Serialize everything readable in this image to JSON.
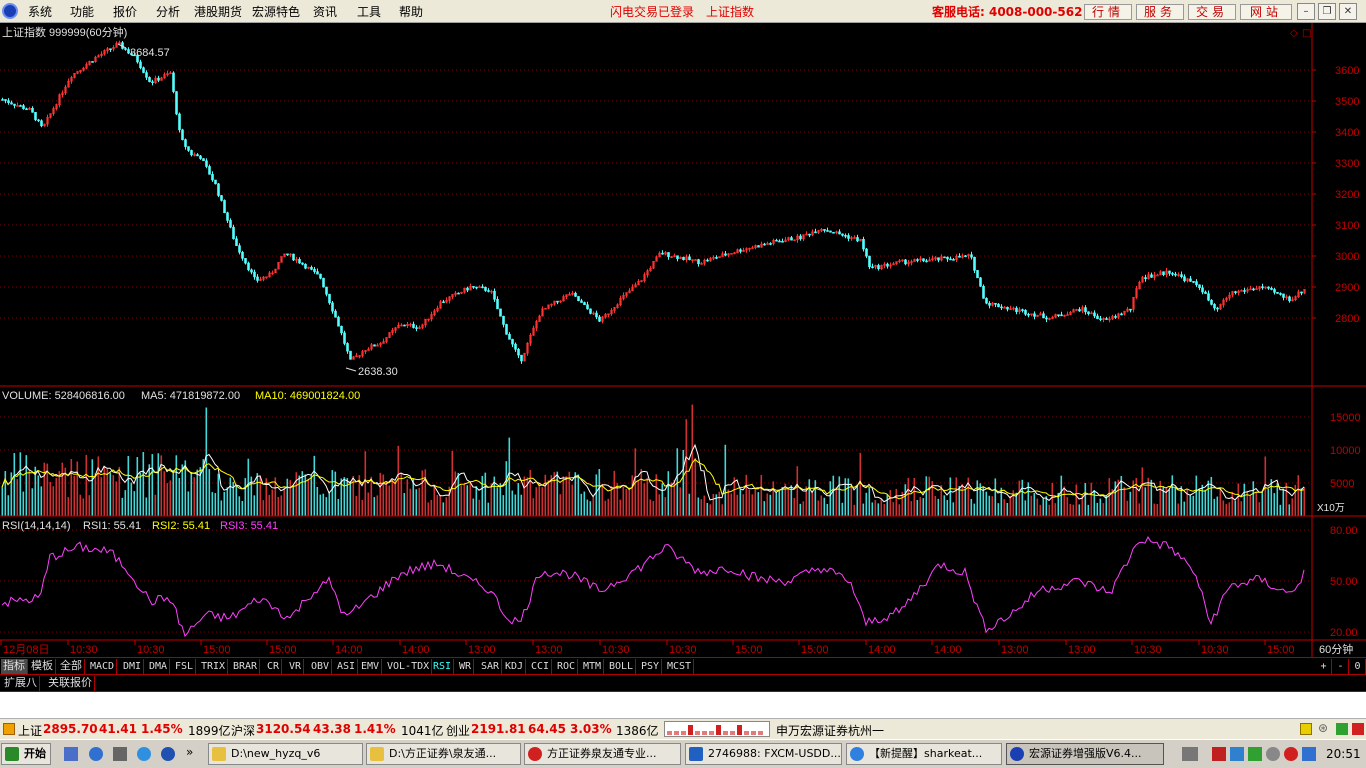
{
  "menubar": {
    "items": [
      "系统",
      "功能",
      "报价",
      "分析",
      "港股期货",
      "宏源特色",
      "资讯",
      "工具",
      "帮助"
    ],
    "status_login": "闪电交易已登录",
    "status_index": "上证指数",
    "hotline": "客服电话: 4008-000-562",
    "service_buttons": [
      "行情",
      "服务",
      "交易",
      "网站"
    ],
    "window_buttons": [
      "minimize-icon",
      "restore-icon",
      "close-icon"
    ]
  },
  "price": {
    "title": "上证指数 999999(60分钟)",
    "high_label": "3684.57",
    "low_label": "2638.30",
    "ticks": [
      "3600",
      "3500",
      "3400",
      "3300",
      "3200",
      "3100",
      "3000",
      "2900",
      "2800"
    ],
    "corner_icons": [
      "diamond-icon",
      "square-icon"
    ]
  },
  "volume": {
    "label": "VOLUME: 528406816.00",
    "ma5": "MA5: 471819872.00",
    "ma10": "MA10: 469001824.00",
    "ticks": [
      "15000",
      "10000",
      "5000"
    ],
    "unit": "X10万"
  },
  "rsi": {
    "label": "RSI(14,14,14)",
    "rsi1": "RSI1: 55.41",
    "rsi2": "RSI2: 55.41",
    "rsi3": "RSI3: 55.41",
    "ticks": [
      "80.00",
      "50.00",
      "20.00"
    ]
  },
  "time_axis": {
    "labels": [
      "12月08日",
      "10:30",
      "10:30",
      "15:00",
      "15:00",
      "14:00",
      "14:00",
      "13:00",
      "13:00",
      "10:30",
      "10:30",
      "15:00",
      "15:00",
      "14:00",
      "14:00",
      "13:00",
      "13:00",
      "10:30",
      "10:30",
      "15:00"
    ],
    "period": "60分钟"
  },
  "indicator_tabs": [
    "指标",
    "模板",
    "全部",
    "MACD",
    "DMI",
    "DMA",
    "FSL",
    "TRIX",
    "BRAR",
    "CR",
    "VR",
    "OBV",
    "ASI",
    "EMV",
    "VOL-TDX",
    "RSI",
    "WR",
    "SAR",
    "KDJ",
    "CCI",
    "ROC",
    "MTM",
    "BOLL",
    "PSY",
    "MCST"
  ],
  "active_tab": "指标",
  "highlighted_tab": "RSI",
  "zoom_buttons": [
    "+",
    "-",
    "0"
  ],
  "sub_tabs": [
    "扩展八",
    "关联报价"
  ],
  "statusbar": {
    "sh_name": "上证",
    "sh_price": "2895.70",
    "sh_chg": "41.41",
    "sh_pct": "1.45%",
    "sh_amt": "1899亿",
    "hs_name": "沪深",
    "hs_price": "3120.54",
    "hs_chg": "43.38",
    "hs_pct": "1.41%",
    "hs_amt": "1041亿",
    "cy_name": "创业",
    "cy_price": "2191.81",
    "cy_chg": "64.45",
    "cy_pct": "3.03%",
    "cy_amt": "1386亿",
    "broker": "申万宏源证券杭州一"
  },
  "taskbar": {
    "start": "开始",
    "tasks": [
      "D:\\new_hyzq_v6",
      "D:\\方正证券\\泉友通...",
      "方正证券泉友通专业...",
      "2746988: FXCM-USDD...",
      "【新提醒】sharkeat...",
      "宏源证券增强版V6.4..."
    ],
    "clock": "20:51"
  },
  "colors": {
    "up": "#ff3232",
    "down": "#54ffff",
    "ma5": "#ffffff",
    "ma10": "#ffff00",
    "rsi": "#ff40ff",
    "axis": "#c00000"
  }
}
